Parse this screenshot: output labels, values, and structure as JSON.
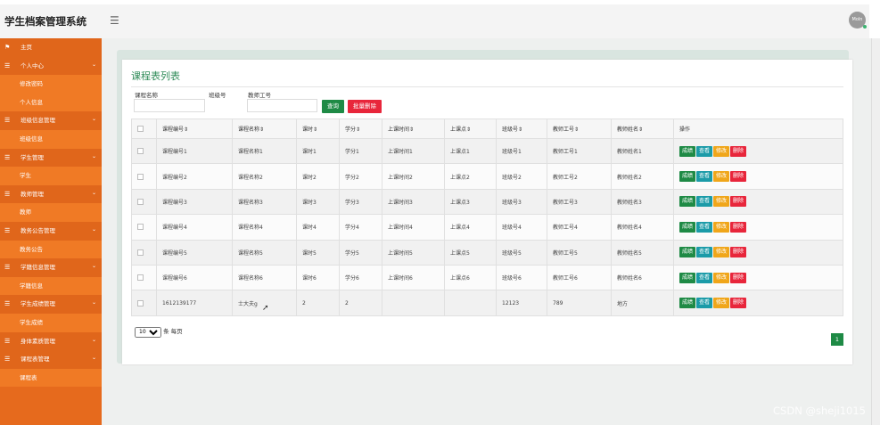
{
  "header": {
    "title": "学生档案管理系统",
    "avatar_text": "Moln"
  },
  "sidebar": {
    "items": [
      {
        "type": "group",
        "icon": "flag",
        "label": "主页",
        "chevron": ""
      },
      {
        "type": "group",
        "icon": "menu",
        "label": "个人中心",
        "chevron": "⌄"
      },
      {
        "type": "sub",
        "label": "修改密码"
      },
      {
        "type": "sub",
        "label": "个人信息"
      },
      {
        "type": "group",
        "icon": "menu",
        "label": "班级信息管理",
        "chevron": "⌄"
      },
      {
        "type": "sub",
        "label": "班级信息"
      },
      {
        "type": "group",
        "icon": "menu",
        "label": "学生管理",
        "chevron": "⌄"
      },
      {
        "type": "sub",
        "label": "学生"
      },
      {
        "type": "group",
        "icon": "menu",
        "label": "教师管理",
        "chevron": "⌄"
      },
      {
        "type": "sub",
        "label": "教师"
      },
      {
        "type": "group",
        "icon": "menu",
        "label": "教务公告管理",
        "chevron": "⌄"
      },
      {
        "type": "sub",
        "label": "教务公告"
      },
      {
        "type": "group",
        "icon": "menu",
        "label": "学籍信息管理",
        "chevron": "⌄"
      },
      {
        "type": "sub",
        "label": "学籍信息"
      },
      {
        "type": "group",
        "icon": "menu",
        "label": "学生成绩管理",
        "chevron": "⌄"
      },
      {
        "type": "sub",
        "label": "学生成绩"
      },
      {
        "type": "group",
        "icon": "menu",
        "label": "身体素质管理",
        "chevron": "⌄"
      },
      {
        "type": "group",
        "icon": "menu",
        "label": "课程表管理",
        "chevron": "⌄"
      },
      {
        "type": "sub",
        "label": "课程表"
      }
    ]
  },
  "page": {
    "title": "课程表列表",
    "filters": {
      "course_name_label": "课程名称",
      "class_no_label": "班级号",
      "teacher_no_label": "教师工号"
    },
    "search_label": "查询",
    "batch_delete_label": "批量删除"
  },
  "table": {
    "columns": [
      "课程编号⇕",
      "课程名称⇕",
      "课时⇕",
      "学分⇕",
      "上课时间⇕",
      "上课点⇕",
      "班级号⇕",
      "教师工号⇕",
      "教师姓名⇕",
      "操作"
    ],
    "rows": [
      [
        "课程编号1",
        "课程名称1",
        "课时1",
        "学分1",
        "上课时间1",
        "上课点1",
        "班级号1",
        "教师工号1",
        "教师姓名1"
      ],
      [
        "课程编号2",
        "课程名称2",
        "课时2",
        "学分2",
        "上课时间2",
        "上课点2",
        "班级号2",
        "教师工号2",
        "教师姓名2"
      ],
      [
        "课程编号3",
        "课程名称3",
        "课时3",
        "学分3",
        "上课时间3",
        "上课点3",
        "班级号3",
        "教师工号3",
        "教师姓名3"
      ],
      [
        "课程编号4",
        "课程名称4",
        "课时4",
        "学分4",
        "上课时间4",
        "上课点4",
        "班级号4",
        "教师工号4",
        "教师姓名4"
      ],
      [
        "课程编号5",
        "课程名称5",
        "课时5",
        "学分5",
        "上课时间5",
        "上课点5",
        "班级号5",
        "教师工号5",
        "教师姓名5"
      ],
      [
        "课程编号6",
        "课程名称6",
        "课时6",
        "学分6",
        "上课时间6",
        "上课点6",
        "班级号6",
        "教师工号6",
        "教师姓名6"
      ],
      [
        "1612139177",
        "士大夫g",
        "2",
        "2",
        "",
        "",
        "12123",
        "789",
        "地方"
      ]
    ],
    "actions": {
      "score": "成绩",
      "view": "查看",
      "edit": "修改",
      "delete": "删除"
    }
  },
  "pagination": {
    "page_size": "10",
    "page_size_suffix": "条 每页",
    "current_page": "1"
  },
  "watermark": "CSDN @sheji1015",
  "colors": {
    "sidebar": "#e66a1d",
    "primary_green": "#1e8a45",
    "danger_red": "#e8263b",
    "view_teal": "#1b9ba8",
    "edit_orange": "#f0a61a"
  }
}
